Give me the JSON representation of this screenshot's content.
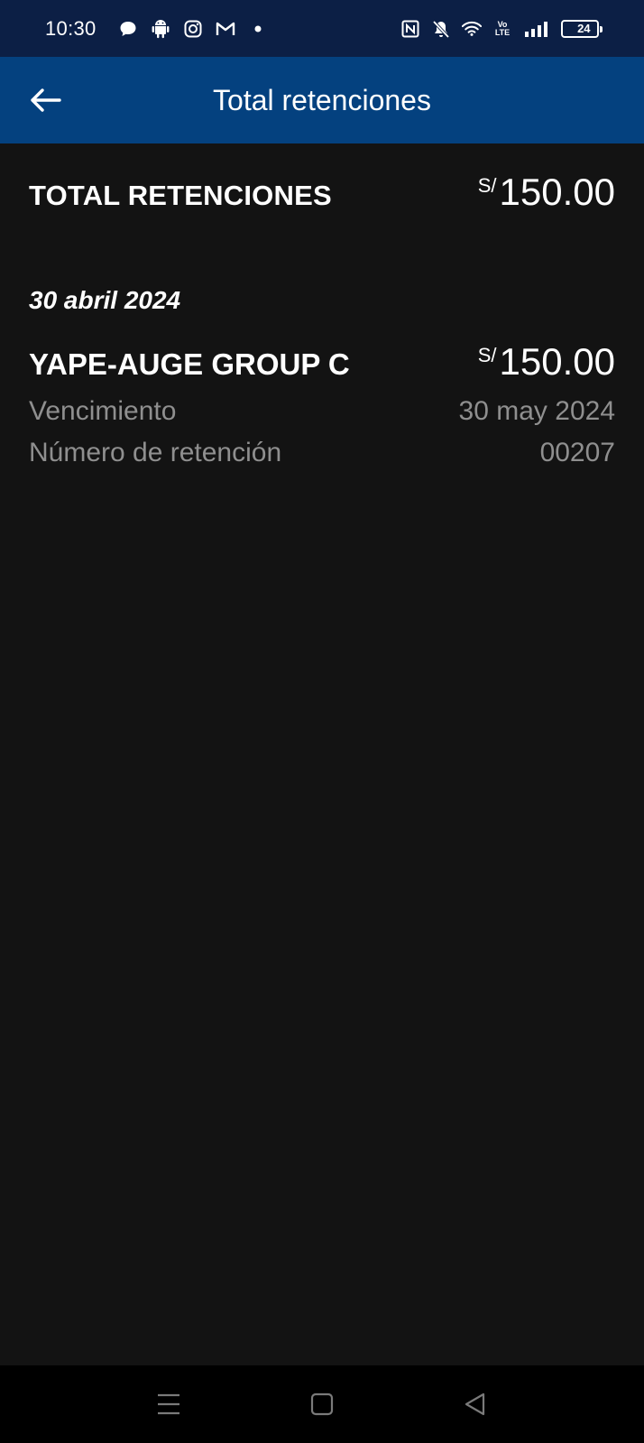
{
  "status_bar": {
    "time": "10:30",
    "battery": "24",
    "volte_top": "Vo",
    "volte_bottom": "LTE",
    "left_icons": [
      "chat-bubble-icon",
      "android-icon",
      "instagram-icon",
      "gmail-icon",
      "dot-icon"
    ],
    "right_icons": [
      "nfc-icon",
      "bell-off-icon",
      "wifi-icon",
      "volte-icon",
      "signal-icon",
      "battery-icon"
    ]
  },
  "app_bar": {
    "title": "Total retenciones"
  },
  "summary": {
    "label": "TOTAL RETENCIONES",
    "currency": "S/",
    "amount": "150.00"
  },
  "groups": [
    {
      "date": "30 abril 2024",
      "items": [
        {
          "name": "YAPE-AUGE GROUP C",
          "currency": "S/",
          "amount": "150.00",
          "due_label": "Vencimiento",
          "due_value": "30 may 2024",
          "number_label": "Número de retención",
          "number_value": "00207"
        }
      ]
    }
  ],
  "nav_bar": {
    "buttons": [
      "menu-icon",
      "home-icon",
      "back-triangle-icon"
    ]
  },
  "colors": {
    "status_bar": "#0c1f45",
    "app_bar": "#04417f",
    "background": "#131313",
    "muted_text": "#8f8f8f",
    "battery_fill": "#d9a23b"
  }
}
